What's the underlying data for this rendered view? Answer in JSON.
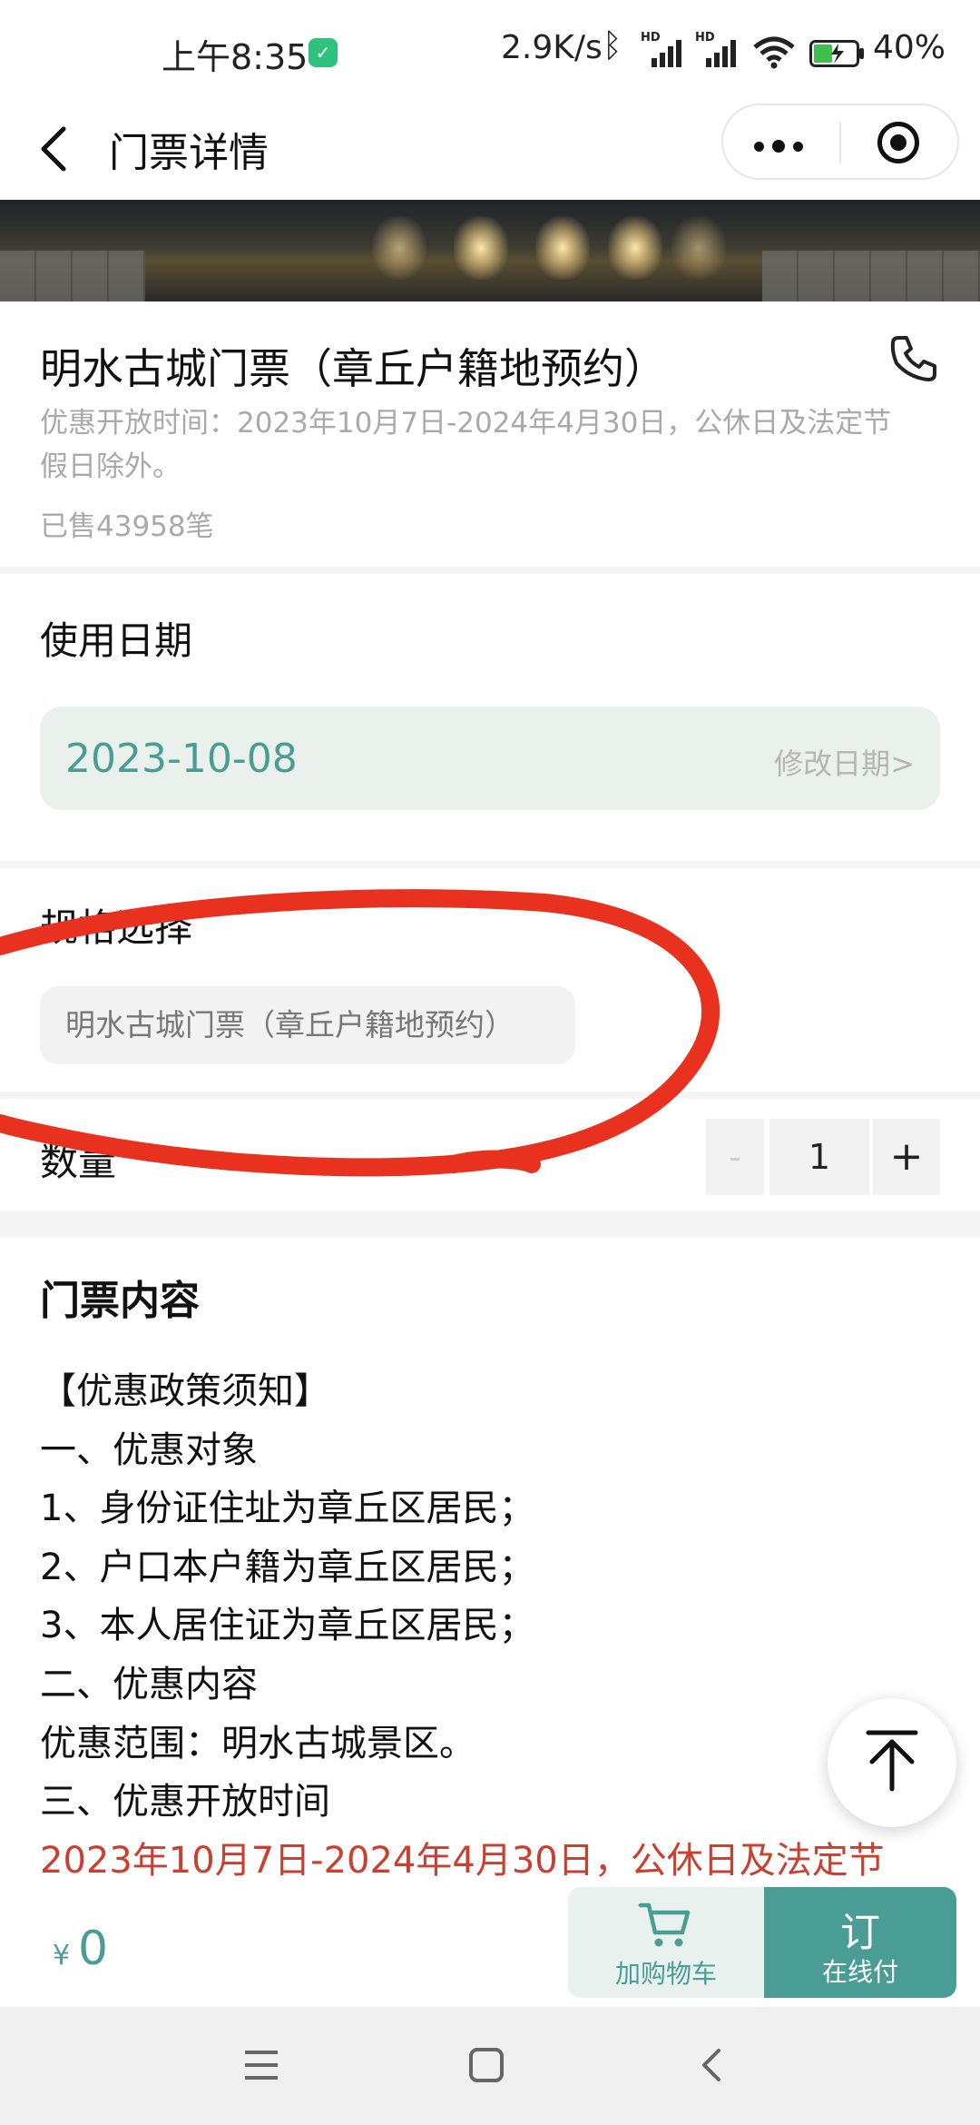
{
  "status_bar": {
    "time": "上午8:35",
    "network_speed": "2.9K/s",
    "battery": "40%",
    "signal_badge": "HD"
  },
  "nav": {
    "title": "门票详情"
  },
  "ticket": {
    "name": "明水古城门票（章丘户籍地预约）",
    "open_time_lines": [
      "优惠开放时间：2023年10月7日-2024年4月30日，公休日及法定节",
      "假日除外。"
    ],
    "sold": "已售43958笔"
  },
  "date_section": {
    "title": "使用日期",
    "date": "2023-10-08",
    "modify": "修改日期>"
  },
  "spec_section": {
    "title": "规格选择",
    "option": "明水古城门票（章丘户籍地预约）"
  },
  "quantity": {
    "label": "数量",
    "minus": "-",
    "value": "1",
    "plus": "+"
  },
  "content": {
    "title": "门票内容",
    "lines": [
      "【优惠政策须知】",
      "一、优惠对象",
      "1、身份证住址为章丘区居民；",
      "2、户口本户籍为章丘区居民；",
      "3、本人居住证为章丘区居民；",
      "二、优惠内容",
      "优惠范围：明水古城景区。",
      "三、优惠开放时间"
    ],
    "highlight_line": "2023年10月7日-2024年4月30日，公休日及法定节"
  },
  "bottom_bar": {
    "currency": "¥",
    "price": "0",
    "cart_label": "加购物车",
    "order_main": "订",
    "order_sub": "在线付"
  },
  "colors": {
    "accent": "#4a9d95",
    "highlight_red": "#c8402f",
    "annotation_red": "#e8321f"
  },
  "icons": [
    "shield-icon",
    "bluetooth-icon",
    "signal-icon",
    "wifi-icon",
    "battery-icon",
    "back-arrow-icon",
    "more-dots-icon",
    "target-icon",
    "phone-icon",
    "cart-icon",
    "arrow-up-icon",
    "menu-icon",
    "home-square-icon",
    "back-chevron-icon"
  ]
}
